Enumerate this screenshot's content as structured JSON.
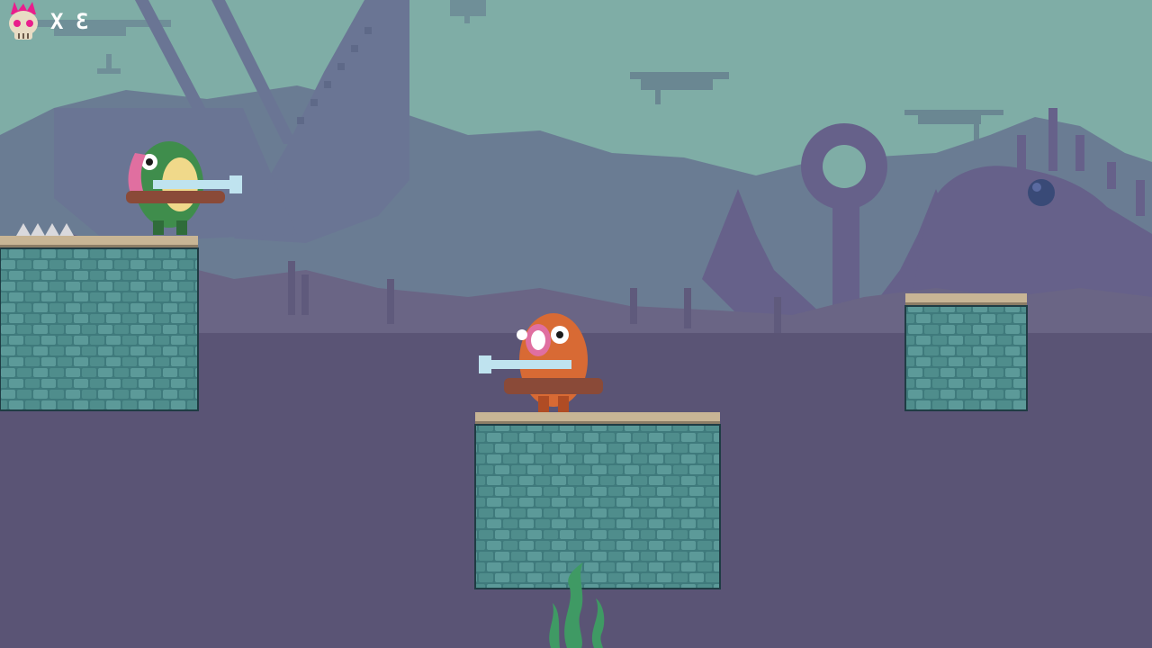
{
  "game": {
    "title": "",
    "hud": {
      "icon": "pink-flame-skull-icon",
      "lives_prefix": "X",
      "lives_count": "3"
    },
    "colors": {
      "sky": "#7fada6",
      "far_silhouette": "#6a7c93",
      "mid_silhouette": "#6a6585",
      "ground_fog": "#5a5475",
      "brick": "#3f7a7c",
      "brick_light": "#5c9a99",
      "brick_dark": "#1f3c44",
      "ledge": "#c8b595",
      "seaweed": "#3f9a64",
      "frog_body": "#3f8d4c",
      "frog_hair": "#e06fa0",
      "orange_body": "#d86a34",
      "mine": "#394a77",
      "gun_metal": "#bfe3ef",
      "gun_stock": "#8a4a38"
    },
    "entities": [
      {
        "name": "green-frog-gunner",
        "facing": "right"
      },
      {
        "name": "orange-screaming-gunner",
        "facing": "left"
      },
      {
        "name": "floating-sea-mine"
      },
      {
        "name": "spike-trap"
      }
    ],
    "scenery": [
      "sunken-ship-wreck",
      "giant-anchor",
      "tentacle-silhouette",
      "floating-airships",
      "seaweed-strands"
    ]
  }
}
